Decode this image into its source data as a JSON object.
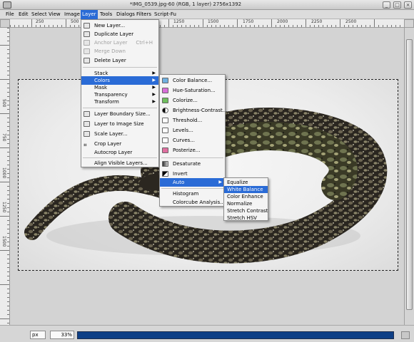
{
  "window": {
    "title": "*IMG_0539.jpg-60 (RGB, 1 layer) 2756x1392"
  },
  "menubar": [
    "File",
    "Edit",
    "Select",
    "View",
    "Image",
    "Layer",
    "Tools",
    "Dialogs",
    "Filters",
    "Script-Fu"
  ],
  "ruler": {
    "h_labels": [
      "250",
      "500",
      "750",
      "1000",
      "1250",
      "1500",
      "1750",
      "2000",
      "2250",
      "2500"
    ],
    "v_labels": [
      "500",
      "750",
      "1000",
      "1250",
      "1500"
    ]
  },
  "layer_menu": {
    "items": [
      {
        "label": "New Layer...",
        "icon": "new-layer-icon",
        "disabled": false
      },
      {
        "label": "Duplicate Layer",
        "icon": "duplicate-layer-icon",
        "disabled": false
      },
      {
        "label": "Anchor Layer",
        "icon": "anchor-icon",
        "disabled": true,
        "shortcut": "Ctrl+H"
      },
      {
        "label": "Merge Down",
        "icon": "merge-down-icon",
        "disabled": true
      },
      {
        "label": "Delete Layer",
        "icon": "delete-layer-icon",
        "disabled": false
      },
      {
        "label": "Stack",
        "submenu": true
      },
      {
        "label": "Colors",
        "submenu": true,
        "selected": true
      },
      {
        "label": "Mask",
        "submenu": true
      },
      {
        "label": "Transparency",
        "submenu": true
      },
      {
        "label": "Transform",
        "submenu": true
      },
      {
        "label": "Layer Boundary Size...",
        "icon": "layer-boundary-icon"
      },
      {
        "label": "Layer to Image Size",
        "icon": "layer-to-image-icon"
      },
      {
        "label": "Scale Layer...",
        "icon": "scale-layer-icon"
      },
      {
        "label": "Crop Layer",
        "icon": "crop-icon"
      },
      {
        "label": "Autocrop Layer"
      },
      {
        "label": "Align Visible Layers..."
      }
    ]
  },
  "colors_menu": {
    "items": [
      {
        "label": "Color Balance...",
        "icon": "color-balance-icon"
      },
      {
        "label": "Hue-Saturation...",
        "icon": "hue-saturation-icon"
      },
      {
        "label": "Colorize...",
        "icon": "colorize-icon"
      },
      {
        "label": "Brightness-Contrast...",
        "icon": "brightness-contrast-icon"
      },
      {
        "label": "Threshold...",
        "icon": "threshold-icon"
      },
      {
        "label": "Levels...",
        "icon": "levels-icon"
      },
      {
        "label": "Curves...",
        "icon": "curves-icon"
      },
      {
        "label": "Posterize...",
        "icon": "posterize-icon"
      },
      {
        "label": "Desaturate",
        "icon": "desaturate-icon"
      },
      {
        "label": "Invert",
        "icon": "invert-icon"
      },
      {
        "label": "Auto",
        "submenu": true,
        "selected": true
      },
      {
        "label": "Histogram"
      },
      {
        "label": "Colorcube Analysis..."
      }
    ]
  },
  "auto_menu": {
    "items": [
      {
        "label": "Equalize"
      },
      {
        "label": "White Balance",
        "selected": true
      },
      {
        "label": "Color Enhance"
      },
      {
        "label": "Normalize"
      },
      {
        "label": "Stretch Contrast"
      },
      {
        "label": "Stretch HSV"
      }
    ]
  },
  "status": {
    "unit": "px",
    "zoom": "33%",
    "progress": 0.0
  }
}
